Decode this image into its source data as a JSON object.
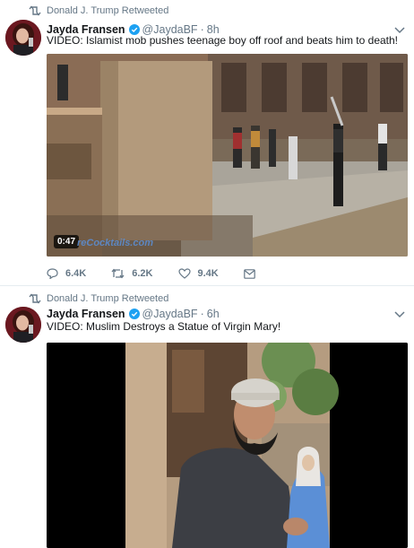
{
  "tweets": [
    {
      "retweeted_by": "Donald J. Trump Retweeted",
      "author_name": "Jayda Fransen",
      "handle": "@JaydaBF",
      "time": "8h",
      "text": "VIDEO: Islamist mob pushes teenage boy off roof and beats him to death!",
      "video": {
        "duration": "0:47",
        "watermark": "reCocktails.com"
      },
      "actions": {
        "replies": "6.4K",
        "retweets": "6.2K",
        "likes": "9.4K"
      }
    },
    {
      "retweeted_by": "Donald J. Trump Retweeted",
      "author_name": "Jayda Fransen",
      "handle": "@JaydaBF",
      "time": "6h",
      "text": "VIDEO: Muslim Destroys a Statue of Virgin Mary!"
    }
  ],
  "icons": {
    "retweet": "retweet-icon",
    "verified": "verified-badge-icon",
    "caret": "chevron-down-icon",
    "reply": "reply-icon",
    "like": "heart-icon",
    "dm": "envelope-icon"
  },
  "colors": {
    "verified": "#1da1f2",
    "muted": "#657786",
    "text": "#14171a"
  }
}
